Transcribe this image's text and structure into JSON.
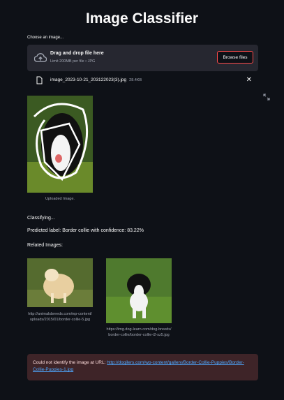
{
  "app": {
    "title": "Image Classifier"
  },
  "uploader": {
    "label": "Choose an image...",
    "drop_title": "Drag and drop file here",
    "limit": "Limit 200MB per file • JPG",
    "browse_label": "Browse files"
  },
  "file": {
    "name": "image_2023-10-21_203122023(3).jpg",
    "size": "28.4KB"
  },
  "uploaded": {
    "caption": "Uploaded Image."
  },
  "status": {
    "classifying": "Classifying...",
    "predicted": "Predicted label: Border collie with confidence: 83.22%",
    "related_heading": "Related Images:"
  },
  "related_images": [
    {
      "caption": "http://animalsbreeds.com/wp-content/uploads/2015/01/border-collie-5.jpg"
    },
    {
      "caption": "https://img.dog-learn.com/dog-breeds/border-collie/border-collie-i2-sz5.jpg"
    }
  ],
  "error": {
    "prefix": "Could not identify the image at URL: ",
    "url": "http://dogilers.com/wp-content/gallery/Border-Collie-Puppies/Border-Collie-Puppies-1.jpg"
  },
  "colors": {
    "background": "#0e1117",
    "accent": "#ff4b4b",
    "dropzone": "#262730",
    "error_bg": "#3e2428",
    "link": "#4ea8ff"
  }
}
